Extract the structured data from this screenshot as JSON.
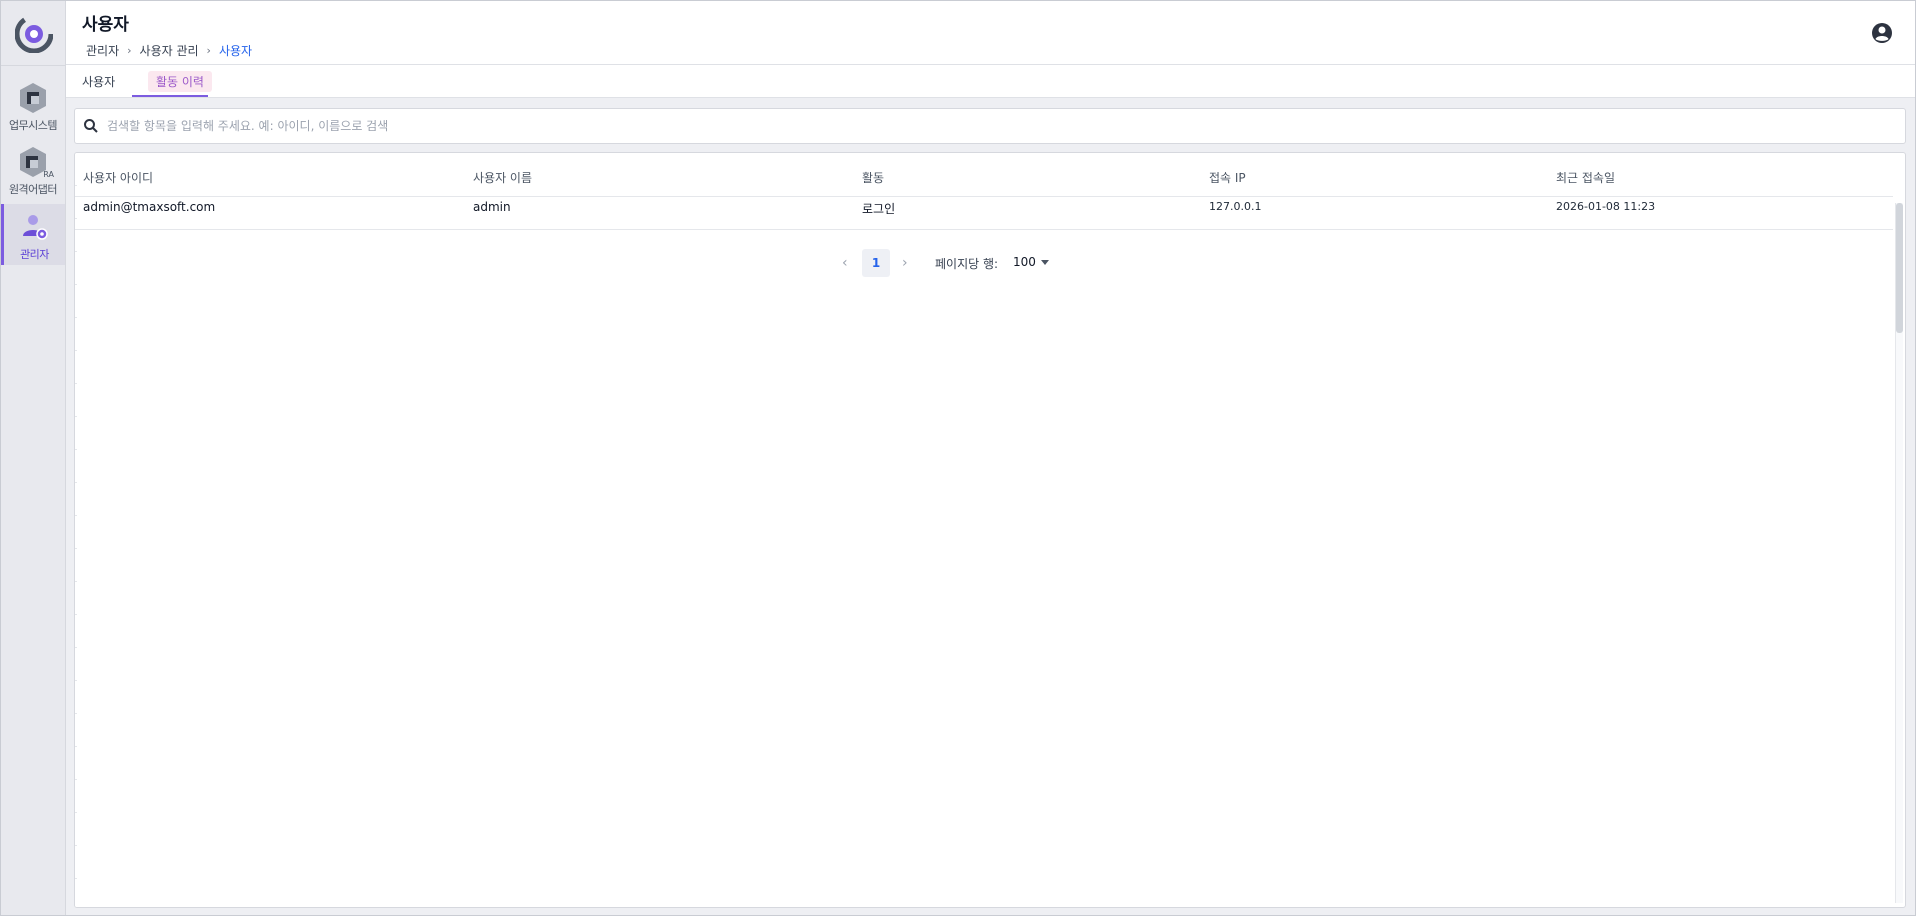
{
  "header": {
    "title": "사용자",
    "breadcrumb": [
      "관리자",
      "사용자 관리",
      "사용자"
    ]
  },
  "sidebar": {
    "items": [
      {
        "label": "업무시스템",
        "icon": "work-system-icon"
      },
      {
        "label": "원격어댑터",
        "icon": "remote-adapter-icon",
        "badge": "RA"
      },
      {
        "label": "관리자",
        "icon": "admin-icon",
        "active": true
      }
    ]
  },
  "tabs": [
    {
      "label": "사용자",
      "active": false
    },
    {
      "label": "활동 이력",
      "active": true
    }
  ],
  "search": {
    "placeholder": "검색할 항목을 입력해 주세요. 예: 아이디, 이름으로 검색",
    "value": ""
  },
  "table": {
    "columns": [
      "사용자 아이디",
      "사용자 이름",
      "활동",
      "접속 IP",
      "최근 접속일"
    ],
    "rows": [
      [
        "admin@tmaxsoft.com",
        "admin",
        "로그인",
        "127.0.0.1",
        "2026-01-08 11:23"
      ]
    ]
  },
  "pagination": {
    "current_page": "1",
    "rows_per_page_label": "페이지당 행:",
    "rows_per_page": "100"
  },
  "colors": {
    "accent": "#7c5ce0",
    "link": "#2563eb",
    "active_tab_text": "#9b59c9",
    "active_tab_bg": "#fbe8ef"
  }
}
